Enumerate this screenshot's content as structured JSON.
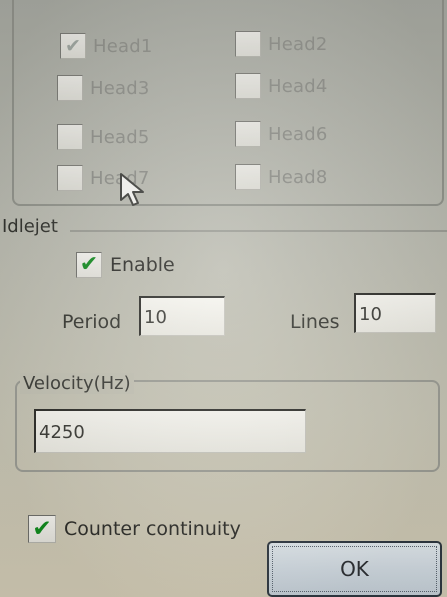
{
  "heads": [
    {
      "label": "Head1",
      "checked": true
    },
    {
      "label": "Head2",
      "checked": false
    },
    {
      "label": "Head3",
      "checked": false
    },
    {
      "label": "Head4",
      "checked": false
    },
    {
      "label": "Head5",
      "checked": false
    },
    {
      "label": "Head6",
      "checked": false
    },
    {
      "label": "Head7",
      "checked": false
    },
    {
      "label": "Head8",
      "checked": false
    }
  ],
  "idlejet": {
    "title": "Idlejet",
    "enable_label": "Enable",
    "enable_checked": true,
    "period_label": "Period",
    "period_value": "10",
    "lines_label": "Lines",
    "lines_value": "10"
  },
  "velocity": {
    "title": "Velocity(Hz)",
    "value": "4250"
  },
  "counter": {
    "label": "Counter continuity",
    "checked": true
  },
  "ok_button": {
    "label": "OK"
  },
  "colors": {
    "check_green": "#1f9a2a",
    "panel_bg": "#b7b8ae",
    "disabled_text": "#8b8c86"
  },
  "icons": {
    "check": "check-icon",
    "cursor": "mouse-pointer-icon"
  }
}
